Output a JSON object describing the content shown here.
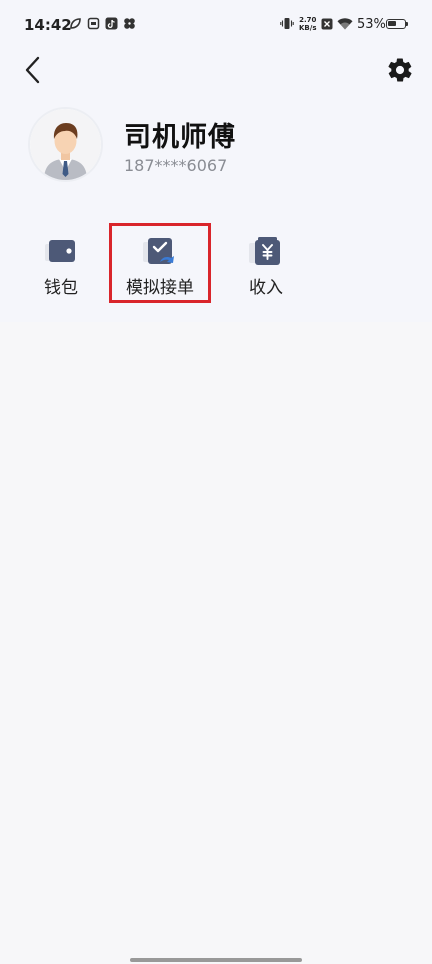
{
  "status_bar": {
    "time": "14:42",
    "net_speed_value": "2.70",
    "net_speed_unit": "KB/s",
    "battery_percent": "53%",
    "battery_level": 0.53
  },
  "header": {
    "back_icon": "chevron-left-icon",
    "settings_icon": "gear-icon"
  },
  "profile": {
    "name": "司机师傅",
    "phone": "187****6067"
  },
  "menu": {
    "items": [
      {
        "label": "钱包",
        "icon": "wallet-icon"
      },
      {
        "label": "模拟接单",
        "icon": "order-check-icon"
      },
      {
        "label": "收入",
        "icon": "income-yen-icon"
      }
    ],
    "highlighted_index": 1
  },
  "colors": {
    "accent_icon": "#4d5977",
    "highlight_border": "#d9252b",
    "icon_blue_tick": "#3a7bd5"
  }
}
